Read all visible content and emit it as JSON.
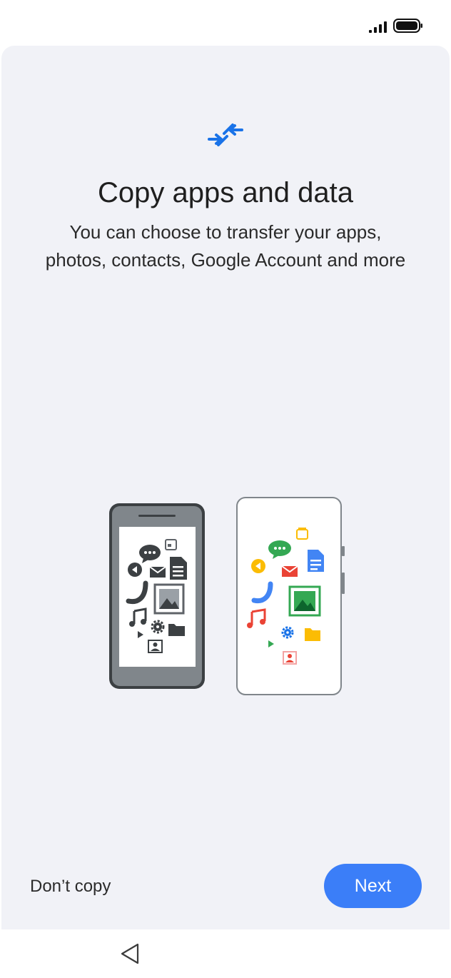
{
  "status_bar": {
    "signal_icon": "cellular-signal-icon",
    "battery_icon": "battery-full-icon"
  },
  "header": {
    "icon": "transfer-arrows-icon",
    "accent_color": "#1a73e8"
  },
  "main": {
    "title": "Copy apps and data",
    "description": "You can choose to transfer your apps, photos, contacts, Google Account and more"
  },
  "illustration": {
    "old_phone_icons": [
      "calendar-icon",
      "chat-icon",
      "document-icon",
      "audio-icon",
      "mail-icon",
      "phone-icon",
      "photo-icon",
      "music-icon",
      "settings-icon",
      "folder-icon",
      "play-icon",
      "contact-icon"
    ],
    "new_phone_icons": [
      "calendar-icon",
      "chat-icon",
      "document-icon",
      "audio-icon",
      "mail-icon",
      "phone-icon",
      "photo-icon",
      "music-icon",
      "settings-icon",
      "folder-icon",
      "play-icon",
      "contact-icon"
    ]
  },
  "actions": {
    "dont_copy_label": "Don’t copy",
    "next_label": "Next",
    "next_color": "#3b7ef8"
  },
  "nav_bar": {
    "back_icon": "back-triangle-icon"
  }
}
